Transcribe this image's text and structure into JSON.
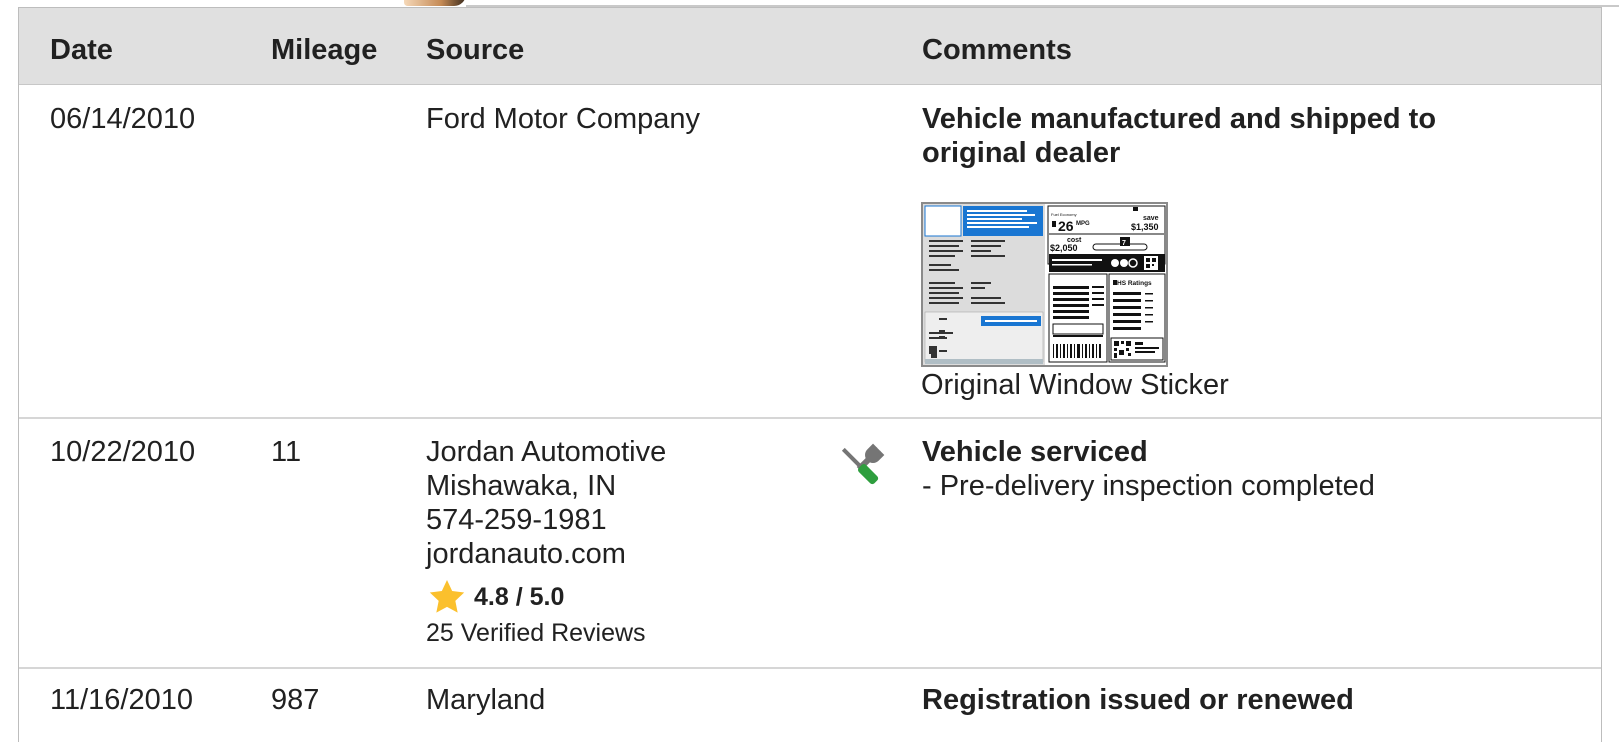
{
  "table": {
    "headers": {
      "date": "Date",
      "mileage": "Mileage",
      "source": "Source",
      "comments": "Comments"
    }
  },
  "rows": [
    {
      "date": "06/14/2010",
      "mileage": "",
      "source": {
        "line1": "Ford Motor Company"
      },
      "comment_title_1": "Vehicle manufactured and shipped to",
      "comment_title_2": "original dealer",
      "sticker_caption": "Original Window Sticker",
      "sticker": {
        "mpg": "26",
        "mpg_unit": "MPG",
        "save_label": "save",
        "save_amount": "$1,350",
        "cost_label": "cost",
        "cost_amount": "$2,050",
        "gauge_value": "7",
        "ratings_label": "HS Ratings"
      }
    },
    {
      "date": "10/22/2010",
      "mileage": "11",
      "source": {
        "line1": "Jordan Automotive",
        "line2": "Mishawaka, IN",
        "line3": "574-259-1981",
        "line4": "jordanauto.com"
      },
      "rating": "4.8 / 5.0",
      "rating_value": 4.8,
      "reviews": "25 Verified Reviews",
      "icon": "wrench-screwdriver-icon",
      "comment_title_1": "Vehicle serviced",
      "comment_detail": "- Pre-delivery inspection completed"
    },
    {
      "date": "11/16/2010",
      "mileage": "987",
      "source": {
        "line1": "Maryland"
      },
      "comment_title_1": "Registration issued or renewed"
    }
  ],
  "colors": {
    "header_bg": "#e0e0e0",
    "star": "#fbc02d",
    "wrench_handle": "#2e9e3e",
    "sticker_blue": "#1976d2"
  }
}
